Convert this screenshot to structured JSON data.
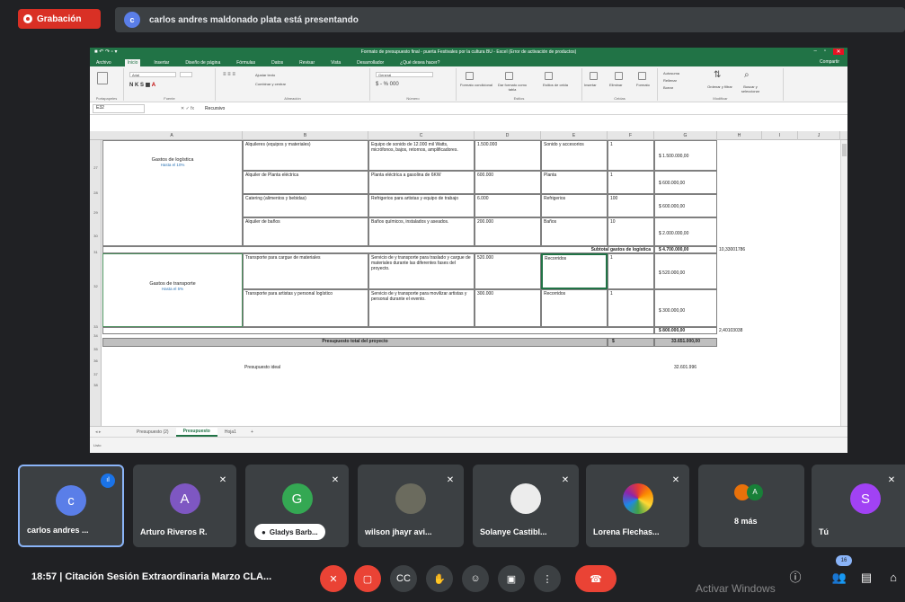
{
  "top": {
    "recording_label": "Grabación",
    "presenter_initial": "c",
    "presenting_text": "carlos andres maldonado plata está presentando"
  },
  "excel": {
    "doc_title": "Formato de presupuesto final - puerta Festivales por la cultura BU - Excel (Error de activación de productos)",
    "tabs": [
      "Archivo",
      "Inicio",
      "Insertar",
      "Diseño de página",
      "Fórmulas",
      "Datos",
      "Revisar",
      "Vista",
      "Desarrollador",
      "¿Qué desea hacer?"
    ],
    "share_label": "Compartir",
    "ribbon_groups": [
      "Portapapeles",
      "Fuente",
      "Alineación",
      "Número",
      "Estilos",
      "Celdas",
      "Modificar"
    ],
    "ribbon_items": {
      "font": "Arial",
      "wrap": "Ajustar texto",
      "merge": "Combinar y centrar",
      "number_format": "General",
      "cond_format": "Formato condicional",
      "table_format": "Dar formato como tabla",
      "cell_styles": "Estilos de celda",
      "insert": "Insertar",
      "delete": "Eliminar",
      "format": "Formato",
      "autosum": "Autosuma",
      "fill": "Rellenar",
      "clear": "Borrar",
      "sort": "Ordenar y filtrar",
      "find": "Buscar y seleccionar"
    },
    "name_box": "E32",
    "formula_value": "Recursivo",
    "columns": [
      "A",
      "B",
      "C",
      "D",
      "E",
      "F",
      "G",
      "H",
      "I",
      "J"
    ],
    "rows": [
      "27",
      "28",
      "29",
      "30",
      "31",
      "32",
      "33",
      "34",
      "35",
      "36",
      "37",
      "38"
    ],
    "groups": [
      {
        "title": "Gastos de logística",
        "subtitle": "Hasta el 10%"
      },
      {
        "title": "Gastos de transporte",
        "subtitle": "Hasta el 5%"
      }
    ],
    "logistics_rows": [
      {
        "item": "Alquileres (equipos y materiales)",
        "desc": "Equipo de sonido de 12.000 mil Watts, micrófonos, bajos, retornos, amplificadores.",
        "value": "1.500.000",
        "unit": "Sonido y accesorios",
        "qty": "1",
        "total": "$ 1.500.000,00"
      },
      {
        "item": "Alquiler de Planta eléctrica",
        "desc": "Planta eléctrica a gasolina de 6KW",
        "value": "600.000",
        "unit": "Planta",
        "qty": "1",
        "total": "$ 600.000,00"
      },
      {
        "item": "Catering (alimentos y bebidas)",
        "desc": "Refrigerios para artistas y equipo de trabajo",
        "value": "6.000",
        "unit": "Refrigerios",
        "qty": "100",
        "total": "$ 600.000,00"
      },
      {
        "item": "Alquiler de baños",
        "desc": "Baños químicos, instalados y aseados.",
        "value": "200.000",
        "unit": "Baños",
        "qty": "10",
        "total": "$ 2.000.000,00"
      }
    ],
    "logistics_subtotal_label": "Subtotal gastos de logística",
    "logistics_subtotal": "$ 4.700.000,00",
    "logistics_pct": "10,33001786",
    "transport_rows": [
      {
        "item": "Transporte para cargue de materiales",
        "desc": "Servicio de y transporte para traslado y cargue de materiales durante las diferentes fases del proyecto.",
        "value": "520.000",
        "unit": "Recorridos",
        "qty": "1",
        "total": "$ 520.000,00"
      },
      {
        "item": "Transporte para artistas y personal logístico",
        "desc": "Servicio de y transporte para movilizar artistas y personal durante el evento.",
        "value": "300.000",
        "unit": "Recorridos",
        "qty": "1",
        "total": "$ 300.000,00"
      }
    ],
    "transport_subtotal": "$ 800.000,00",
    "transport_pct": "2,40103038",
    "total_label": "Presupuesto total del proyecto",
    "total_symbol": "$",
    "total_value": "33.651.000,00",
    "ideal_label": "Presupuesto ideal",
    "ideal_value": "32.601.996",
    "sheet_tabs": [
      "Presupuesto (2)",
      "Presupuesto",
      "Hoja1"
    ],
    "add_sheet": "+",
    "status_left": "Listo"
  },
  "participants": [
    {
      "name": "carlos andres ...",
      "initial": "c",
      "color": "#5a7ee8",
      "speaking": true
    },
    {
      "name": "Arturo Riveros R.",
      "initial": "A",
      "color": "#7e57c2",
      "muted": true
    },
    {
      "name": "Gladys Barb...",
      "initial": "G",
      "color": "#34a853",
      "muted": true
    },
    {
      "name": "wilson jhayr avi...",
      "initial": "",
      "color": "#6b6b5e",
      "muted": true
    },
    {
      "name": "Solanye Castibl...",
      "initial": "",
      "color": "#ececec",
      "muted": true
    },
    {
      "name": "Lorena Flechas...",
      "initial": "",
      "color": "#fff",
      "muted": true
    },
    {
      "name": "8 más",
      "initial": "",
      "color": "#3c4043"
    },
    {
      "name": "Tú",
      "initial": "S",
      "color": "#a142f4",
      "muted": true
    }
  ],
  "bottom": {
    "time_meeting": "18:57  |  Citación Sesión Extraordinaria Marzo CLA...",
    "people_badge": "16",
    "watermark": "Activar Windows"
  },
  "icons": {
    "mic": "mic-off-icon",
    "cam": "cam-off-icon",
    "captions": "captions-icon",
    "hand": "raise-hand-icon",
    "emoji": "emoji-icon",
    "present": "present-icon",
    "more": "more-icon",
    "end": "end-call-icon",
    "info": "info-icon",
    "people": "people-icon",
    "chat": "chat-icon",
    "activities": "activities-icon"
  }
}
